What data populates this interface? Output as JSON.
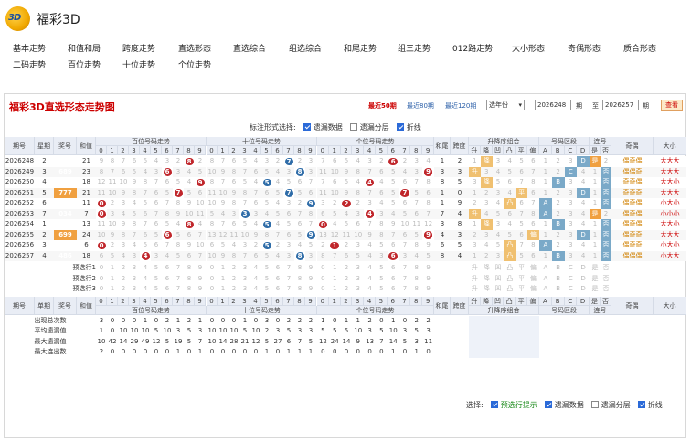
{
  "site": {
    "logo_text": "3D",
    "title": "福彩3D"
  },
  "nav": [
    "基本走势",
    "和值和局",
    "跨度走势",
    "直选形态",
    "直选综合",
    "组选综合",
    "和尾走势",
    "组三走势",
    "012路走势",
    "大小形态",
    "奇偶形态",
    "质合形态",
    "二码走势",
    "百位走势",
    "十位走势",
    "个位走势"
  ],
  "panel": {
    "title": "福彩3D直选形态走势图",
    "recent": [
      "最近50期",
      "最近80期",
      "最近120期"
    ],
    "select": "选年份",
    "from": "2026248",
    "from_label": "期",
    "to_label": "至",
    "to": "2026257",
    "to_suffix": "期",
    "query": "查看"
  },
  "options": {
    "label": "标注形式选择:",
    "items": [
      {
        "t": "遗漏数据",
        "on": true
      },
      {
        "t": "遗漏分层",
        "on": false
      },
      {
        "t": "折线",
        "on": true
      }
    ]
  },
  "headers": {
    "period": "期号",
    "week": "星期",
    "prize": "奖号",
    "sum": "和值",
    "hundred": "百位号码走势",
    "ten": "十位号码走势",
    "unit": "个位号码走势",
    "tail": "和尾",
    "span": "跨度",
    "order": "升降序组合",
    "zone": "号码区段",
    "link": "连号",
    "parity": "奇偶",
    "size": "大小",
    "digits": [
      "0",
      "1",
      "2",
      "3",
      "4",
      "5",
      "6",
      "7",
      "8",
      "9"
    ],
    "order_cols": [
      "升",
      "降",
      "凹",
      "凸",
      "平",
      "偏"
    ],
    "zone_cols": [
      "A",
      "B",
      "C",
      "D"
    ],
    "link_cols": [
      "是",
      "否"
    ],
    "week2": "单期"
  },
  "rows": [
    {
      "p": "2026248",
      "w": "2",
      "n": "876",
      "s": "21",
      "h": 8,
      "t": 7,
      "u": 6,
      "tail": "1",
      "span": "2",
      "ord": "降",
      "zone": "D",
      "link": "是",
      "par": "偶奇偶",
      "sz": "大大大"
    },
    {
      "p": "2026249",
      "w": "3",
      "n": "689",
      "s": "23",
      "h": 6,
      "t": 8,
      "u": 9,
      "tail": "3",
      "span": "3",
      "ord": "升",
      "zone": "C",
      "link": "否",
      "par": "偶偶奇",
      "sz": "大大大"
    },
    {
      "p": "2026250",
      "w": "4",
      "n": "954",
      "s": "18",
      "h": 9,
      "t": 5,
      "u": 4,
      "tail": "8",
      "span": "5",
      "ord": "降",
      "zone": "B",
      "link": "否",
      "par": "奇奇偶",
      "sz": "大大小"
    },
    {
      "p": "2026251",
      "w": "5",
      "n": "777",
      "s": "21",
      "h": 7,
      "t": 7,
      "u": 7,
      "tail": "1",
      "span": "0",
      "ord": "平",
      "zone": "D",
      "link": "否",
      "par": "奇奇奇",
      "sz": "大大大"
    },
    {
      "p": "2026252",
      "w": "6",
      "n": "092",
      "s": "11",
      "h": 0,
      "t": 9,
      "u": 2,
      "tail": "1",
      "span": "9",
      "ord": "凸",
      "zone": "A",
      "link": "否",
      "par": "偶奇偶",
      "sz": "小大小"
    },
    {
      "p": "2026253",
      "w": "7",
      "n": "034",
      "s": "7",
      "h": 0,
      "t": 3,
      "u": 4,
      "tail": "7",
      "span": "4",
      "ord": "升",
      "zone": "A",
      "link": "是",
      "par": "偶奇偶",
      "sz": "小小小"
    },
    {
      "p": "2026254",
      "w": "1",
      "n": "850",
      "s": "13",
      "h": 8,
      "t": 5,
      "u": 0,
      "tail": "3",
      "span": "8",
      "ord": "降",
      "zone": "B",
      "link": "否",
      "par": "偶奇偶",
      "sz": "大大小"
    },
    {
      "p": "2026255",
      "w": "2",
      "n": "699",
      "s": "24",
      "h": 6,
      "t": 9,
      "u": 9,
      "tail": "4",
      "span": "3",
      "ord": "偏",
      "zone": "D",
      "link": "否",
      "par": "偶奇奇",
      "sz": "大大大"
    },
    {
      "p": "2026256",
      "w": "3",
      "n": "051",
      "s": "6",
      "h": 0,
      "t": 5,
      "u": 1,
      "tail": "6",
      "span": "5",
      "ord": "凸",
      "zone": "A",
      "link": "否",
      "par": "偶奇奇",
      "sz": "小大小"
    },
    {
      "p": "2026257",
      "w": "4",
      "n": "486",
      "s": "18",
      "h": 4,
      "t": 8,
      "u": 6,
      "tail": "8",
      "span": "4",
      "ord": "凸",
      "zone": "B",
      "link": "否",
      "par": "偶偶偶",
      "sz": "小大大"
    }
  ],
  "pre": [
    "预选行1",
    "预选行2",
    "预选行3"
  ],
  "stats": [
    {
      "l": "出现总次数",
      "v": [
        "3",
        "0",
        "0",
        "0",
        "1",
        "0",
        "2",
        "1",
        "2",
        "1",
        "0",
        "0",
        "0",
        "1",
        "0",
        "3",
        "0",
        "2",
        "2",
        "2",
        "1",
        "0",
        "1",
        "1",
        "2",
        "0",
        "1",
        "0",
        "2",
        "2"
      ]
    },
    {
      "l": "平均遗漏值",
      "v": [
        "1",
        "0",
        "10",
        "10",
        "10",
        "5",
        "10",
        "3",
        "5",
        "3",
        "10",
        "10",
        "10",
        "5",
        "10",
        "2",
        "3",
        "5",
        "3",
        "3",
        "5",
        "5",
        "5",
        "10",
        "3",
        "5",
        "10",
        "3",
        "5",
        "3"
      ]
    },
    {
      "l": "最大遗漏值",
      "v": [
        "10",
        "42",
        "14",
        "29",
        "49",
        "12",
        "5",
        "19",
        "5",
        "7",
        "10",
        "14",
        "28",
        "21",
        "12",
        "5",
        "27",
        "6",
        "7",
        "5",
        "12",
        "24",
        "14",
        "9",
        "13",
        "7",
        "14",
        "5",
        "3",
        "11"
      ]
    },
    {
      "l": "最大连出数",
      "v": [
        "2",
        "0",
        "0",
        "0",
        "0",
        "0",
        "0",
        "1",
        "0",
        "1",
        "0",
        "0",
        "0",
        "0",
        "0",
        "1",
        "0",
        "1",
        "1",
        "1",
        "0",
        "0",
        "0",
        "0",
        "0",
        "0",
        "1",
        "0",
        "1",
        "0"
      ]
    }
  ],
  "foot": {
    "label": "选择:",
    "items": [
      {
        "t": "预选行提示",
        "on": true,
        "c": "#1a8a1a"
      },
      {
        "t": "遗漏数据",
        "on": true
      },
      {
        "t": "遗漏分层",
        "on": false
      },
      {
        "t": "折线",
        "on": true
      }
    ]
  }
}
